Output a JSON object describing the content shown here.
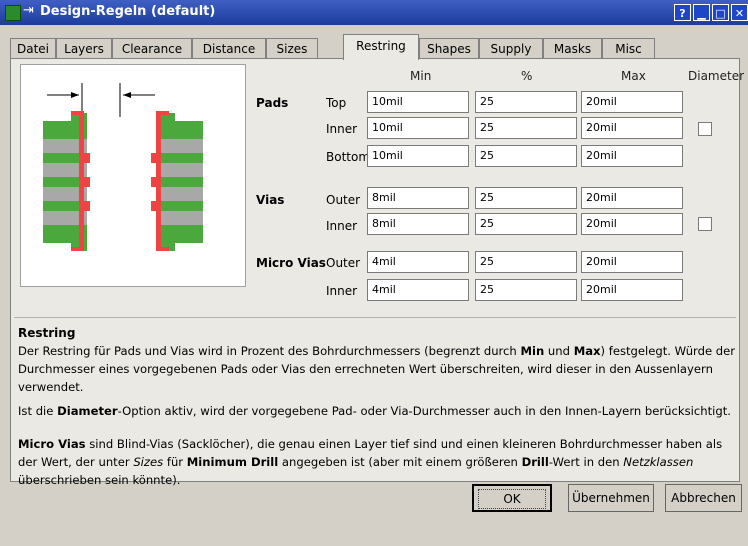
{
  "window": {
    "title": "Design-Regeln (default)"
  },
  "titlebar_buttons": [
    "?",
    "",
    ""
  ],
  "tabs": [
    "Datei",
    "Layers",
    "Clearance",
    "Distance",
    "Sizes",
    "Restring",
    "Shapes",
    "Supply",
    "Masks",
    "Misc"
  ],
  "active_tab": "Restring",
  "headers": {
    "min": "Min",
    "percent": "%",
    "max": "Max",
    "diameter": "Diameter"
  },
  "groups": {
    "pads": {
      "label": "Pads",
      "rows": [
        {
          "label": "Top",
          "min": "10mil",
          "percent": "25",
          "max": "20mil"
        },
        {
          "label": "Inner",
          "min": "10mil",
          "percent": "25",
          "max": "20mil"
        },
        {
          "label": "Bottom",
          "min": "10mil",
          "percent": "25",
          "max": "20mil"
        }
      ]
    },
    "vias": {
      "label": "Vias",
      "rows": [
        {
          "label": "Outer",
          "min": "8mil",
          "percent": "25",
          "max": "20mil"
        },
        {
          "label": "Inner",
          "min": "8mil",
          "percent": "25",
          "max": "20mil"
        }
      ]
    },
    "microvias": {
      "label": "Micro Vias",
      "rows": [
        {
          "label": "Outer",
          "min": "4mil",
          "percent": "25",
          "max": "20mil"
        },
        {
          "label": "Inner",
          "min": "4mil",
          "percent": "25",
          "max": "20mil"
        }
      ]
    }
  },
  "diameter_checkboxes": {
    "pads_inner": false,
    "vias_inner": false
  },
  "help": {
    "title": "Restring",
    "p1": [
      {
        "t": "Der Restring für Pads und Vias wird in Prozent des Bohrdurchmessers (begrenzt durch "
      },
      {
        "t": "Min",
        "b": true
      },
      {
        "t": " und "
      },
      {
        "t": "Max",
        "b": true
      },
      {
        "t": ") festgelegt. Würde der Durchmesser eines vorgegebenen Pads oder Vias den errechneten Wert überschreiten, wird dieser in den Aussenlayern verwendet."
      }
    ],
    "p2": [
      {
        "t": "Ist die "
      },
      {
        "t": "Diameter",
        "b": true
      },
      {
        "t": "-Option aktiv, wird der vorgegebene Pad- oder Via-Durchmesser auch in den Innen-Layern berücksichtigt."
      }
    ],
    "p3": [
      {
        "t": "Micro Vias",
        "b": true
      },
      {
        "t": " sind Blind-Vias (Sacklöcher), die genau einen Layer tief sind und einen kleineren Bohrdurchmesser haben als der Wert, der unter "
      },
      {
        "t": "Sizes",
        "i": true
      },
      {
        "t": " für "
      },
      {
        "t": "Minimum Drill",
        "b": true
      },
      {
        "t": " angegeben ist (aber mit einem größeren "
      },
      {
        "t": "Drill",
        "b": true
      },
      {
        "t": "-Wert in den "
      },
      {
        "t": "Netzklassen",
        "i": true
      },
      {
        "t": " überschrieben sein könnte)."
      }
    ]
  },
  "buttons": {
    "ok": "OK",
    "apply": "Übernehmen",
    "cancel": "Abbrechen"
  },
  "colors": {
    "copper": "#4aa83c",
    "restring": "#ee4444",
    "laminate": "#a8a8a8",
    "titlebar": "#2a4fb8"
  }
}
